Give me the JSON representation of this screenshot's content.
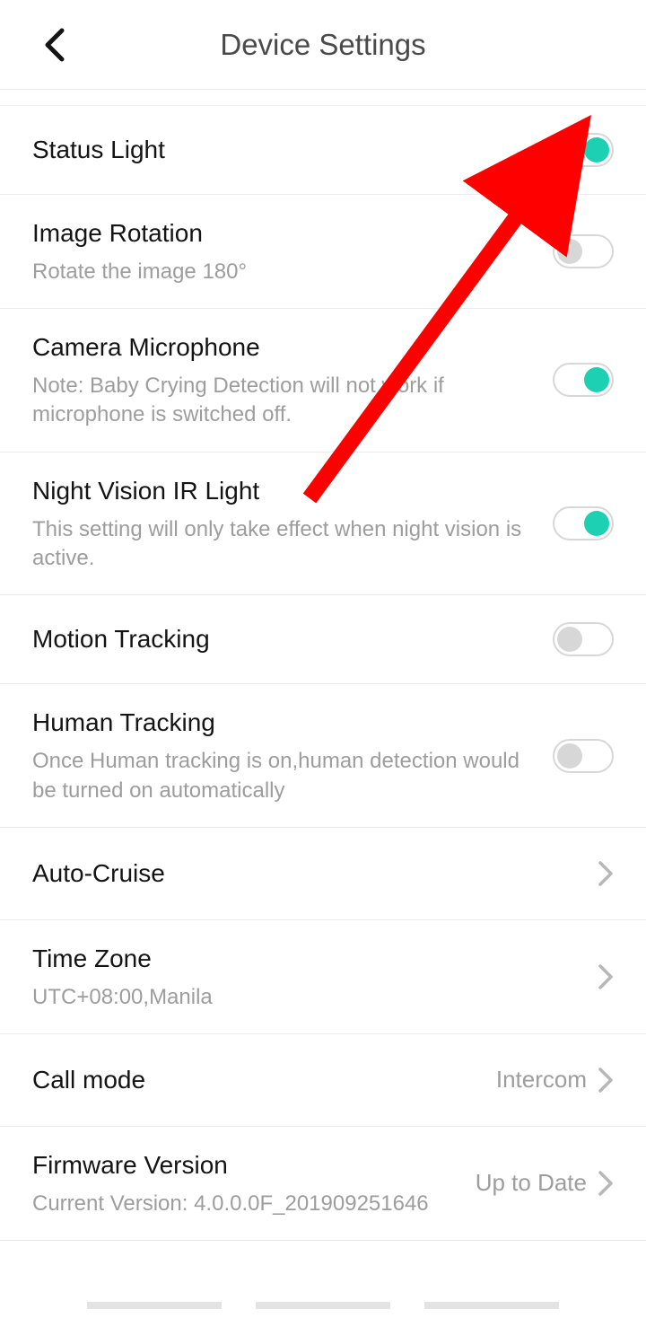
{
  "header": {
    "title": "Device Settings"
  },
  "rows": {
    "status_light": {
      "title": "Status Light"
    },
    "image_rotation": {
      "title": "Image Rotation",
      "sub": "Rotate the image 180°"
    },
    "camera_mic": {
      "title": "Camera Microphone",
      "sub": "Note: Baby Crying Detection will not work if microphone is switched off."
    },
    "night_vision": {
      "title": "Night Vision IR Light",
      "sub": "This setting will only take effect when night vision is active."
    },
    "motion_tracking": {
      "title": "Motion Tracking"
    },
    "human_tracking": {
      "title": "Human Tracking",
      "sub": "Once Human tracking is on,human detection would be turned on automatically"
    },
    "auto_cruise": {
      "title": "Auto-Cruise"
    },
    "time_zone": {
      "title": "Time Zone",
      "sub": "UTC+08:00,Manila"
    },
    "call_mode": {
      "title": "Call mode",
      "value": "Intercom"
    },
    "firmware": {
      "title": "Firmware Version",
      "sub": "Current Version: 4.0.0.0F_201909251646",
      "value": "Up to Date"
    }
  }
}
